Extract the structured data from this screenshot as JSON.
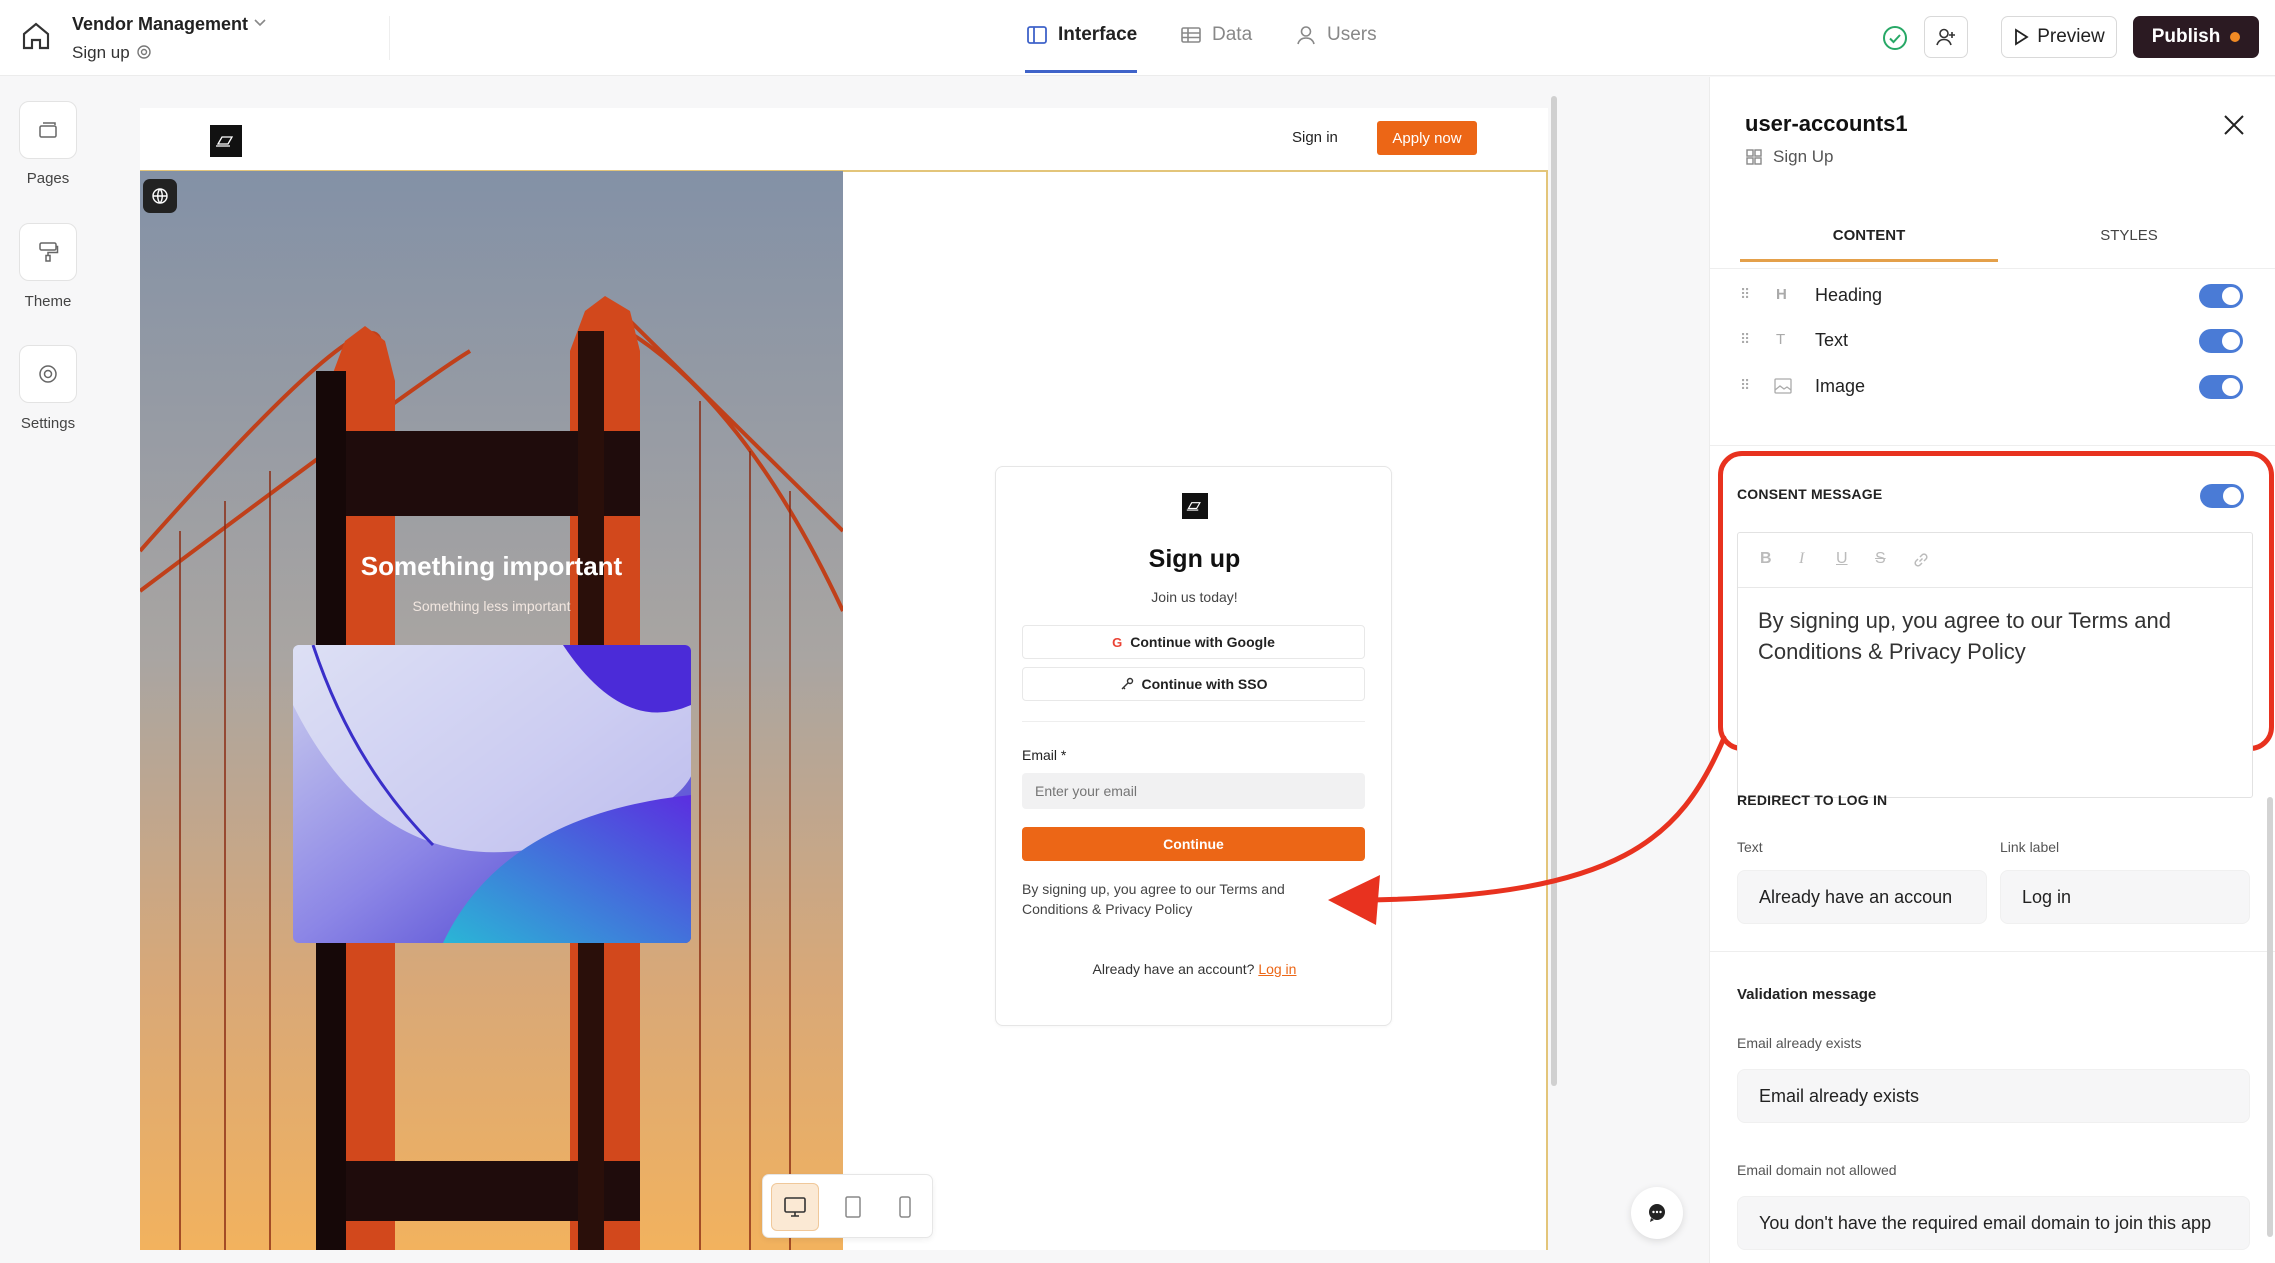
{
  "topbar": {
    "app_name": "Vendor Management",
    "page_name": "Sign up",
    "tabs": [
      {
        "label": "Interface",
        "icon": "layout-icon",
        "active": true
      },
      {
        "label": "Data",
        "icon": "table-icon",
        "active": false
      },
      {
        "label": "Users",
        "icon": "user-icon",
        "active": false
      }
    ],
    "preview_label": "Preview",
    "publish_label": "Publish",
    "publish_dot_color": "#f08a24",
    "brand_dark": "#2b1a22"
  },
  "rail": {
    "items": [
      {
        "label": "Pages",
        "icon": "pages-icon"
      },
      {
        "label": "Theme",
        "icon": "paint-roller-icon"
      },
      {
        "label": "Settings",
        "icon": "gear-icon"
      }
    ]
  },
  "canvas": {
    "nav": {
      "signin_label": "Sign in",
      "apply_label": "Apply now"
    },
    "hero": {
      "title": "Something important",
      "subtitle": "Something less important"
    },
    "signup": {
      "title": "Sign up",
      "subtitle": "Join us today!",
      "google_label": "Continue with Google",
      "sso_label": "Continue with SSO",
      "email_label": "Email *",
      "email_placeholder": "Enter your email",
      "continue_label": "Continue",
      "consent": "By signing up, you agree to our Terms and Conditions & Privacy Policy",
      "already": "Already have an account?",
      "login_link": "Log in"
    },
    "accent_color": "#ec6616"
  },
  "panel": {
    "title": "user-accounts1",
    "subtitle": "Sign Up",
    "tabs": [
      {
        "label": "CONTENT",
        "active": true
      },
      {
        "label": "STYLES",
        "active": false
      }
    ],
    "components": [
      {
        "label": "Heading",
        "icon": "heading-icon",
        "enabled": true
      },
      {
        "label": "Text",
        "icon": "text-icon",
        "enabled": true
      },
      {
        "label": "Image",
        "icon": "image-icon",
        "enabled": true
      }
    ],
    "consent": {
      "heading": "CONSENT MESSAGE",
      "enabled": true,
      "text": "By signing up, you agree to our Terms and Conditions & Privacy Policy"
    },
    "redirect": {
      "heading": "REDIRECT TO LOG IN",
      "text_label": "Text",
      "text_value": "Already have an accoun",
      "link_label": "Link label",
      "link_value": "Log in"
    },
    "validation": {
      "heading": "Validation message",
      "exists_label": "Email already exists",
      "exists_value": "Email already exists",
      "domain_label": "Email domain not allowed",
      "domain_value": "You don't have the required email domain to join this app"
    },
    "toggle_color": "#4a7bd6",
    "highlight_color": "#e8321f"
  }
}
